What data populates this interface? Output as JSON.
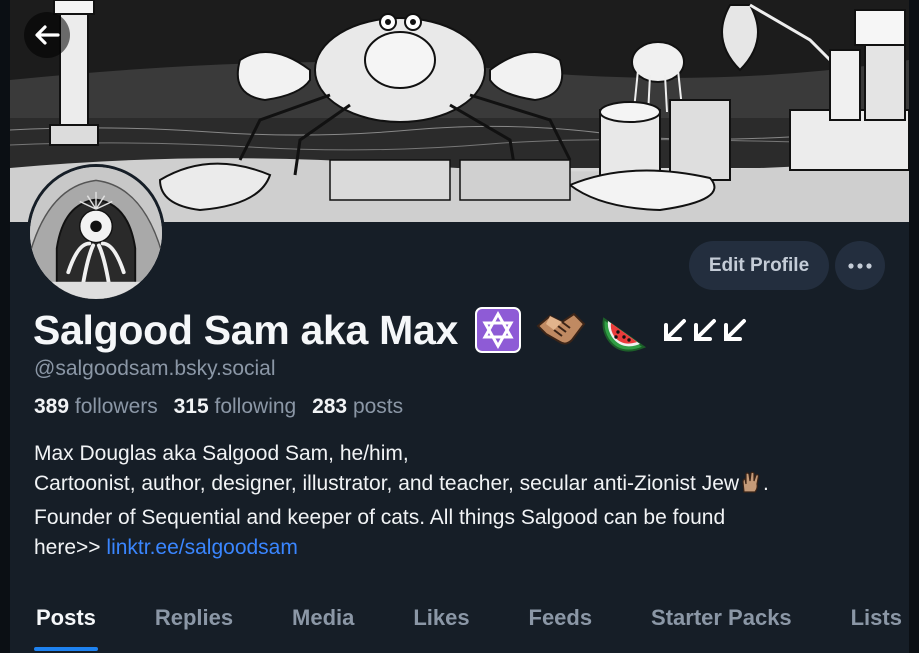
{
  "profile": {
    "display_name": "Salgood Sam aka Max",
    "handle": "@salgoodsam.bsky.social",
    "name_emojis": [
      "star-of-david-emoji",
      "handshake-emoji",
      "watermelon-emoji",
      "arrow-down-left-emoji",
      "arrow-down-left-emoji",
      "arrow-down-left-emoji"
    ]
  },
  "stats": {
    "followers_count": "389",
    "followers_label": "followers",
    "following_count": "315",
    "following_label": "following",
    "posts_count": "283",
    "posts_label": "posts"
  },
  "bio": {
    "line1": "Max Douglas aka Salgood Sam, he/him,",
    "line2_before": "Cartoonist, author, designer, illustrator, and teacher, secular anti-Zionist Jew",
    "line2_after": ".",
    "line3": "Founder of Sequential and keeper of cats. All things Salgood can be found",
    "line4_prefix": "here>> ",
    "link": "linktr.ee/salgoodsam"
  },
  "actions": {
    "edit_profile_label": "Edit Profile",
    "more_icon": "ellipsis-icon",
    "back_icon": "arrow-left-icon"
  },
  "tabs": [
    "Posts",
    "Replies",
    "Media",
    "Likes",
    "Feeds",
    "Starter Packs",
    "Lists"
  ],
  "colors": {
    "background": "#161e27",
    "accent": "#1e82f0",
    "link": "#3a86ff",
    "muted_text": "#8b97a6",
    "button_bg": "#232e3e"
  }
}
